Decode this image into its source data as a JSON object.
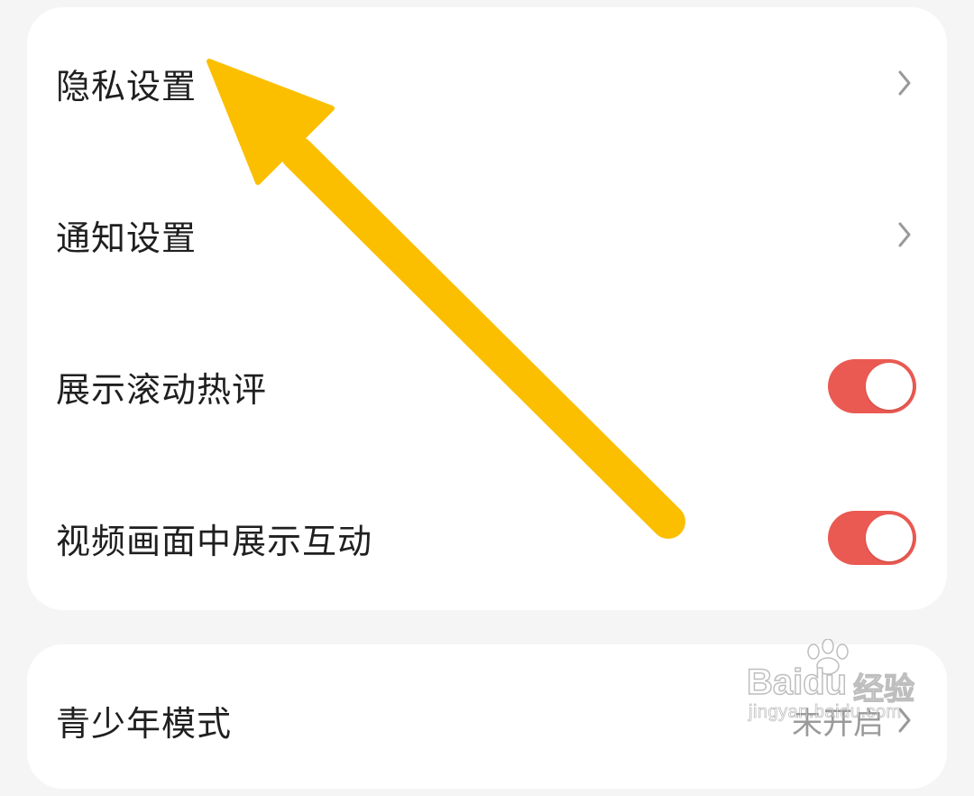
{
  "settings": {
    "items": [
      {
        "label": "隐私设置",
        "control": "chevron"
      },
      {
        "label": "通知设置",
        "control": "chevron"
      },
      {
        "label": "展示滚动热评",
        "control": "toggle",
        "on": true
      },
      {
        "label": "视频画面中展示互动",
        "control": "toggle",
        "on": true
      }
    ]
  },
  "settings2": {
    "items": [
      {
        "label": "青少年模式",
        "value": "未开启",
        "control": "chevron"
      }
    ]
  },
  "annotation": {
    "type": "arrow",
    "color": "#fbbf00",
    "points_to": "隐私设置"
  },
  "watermark": {
    "brand": "Baidu",
    "brand2": "经验",
    "url": "jingyan.baidu.com"
  },
  "colors": {
    "toggle_on": "#ea5a52",
    "background": "#f5f5f5",
    "card": "#ffffff",
    "label": "#1f1f1f",
    "chevron": "#9a9a9a"
  }
}
